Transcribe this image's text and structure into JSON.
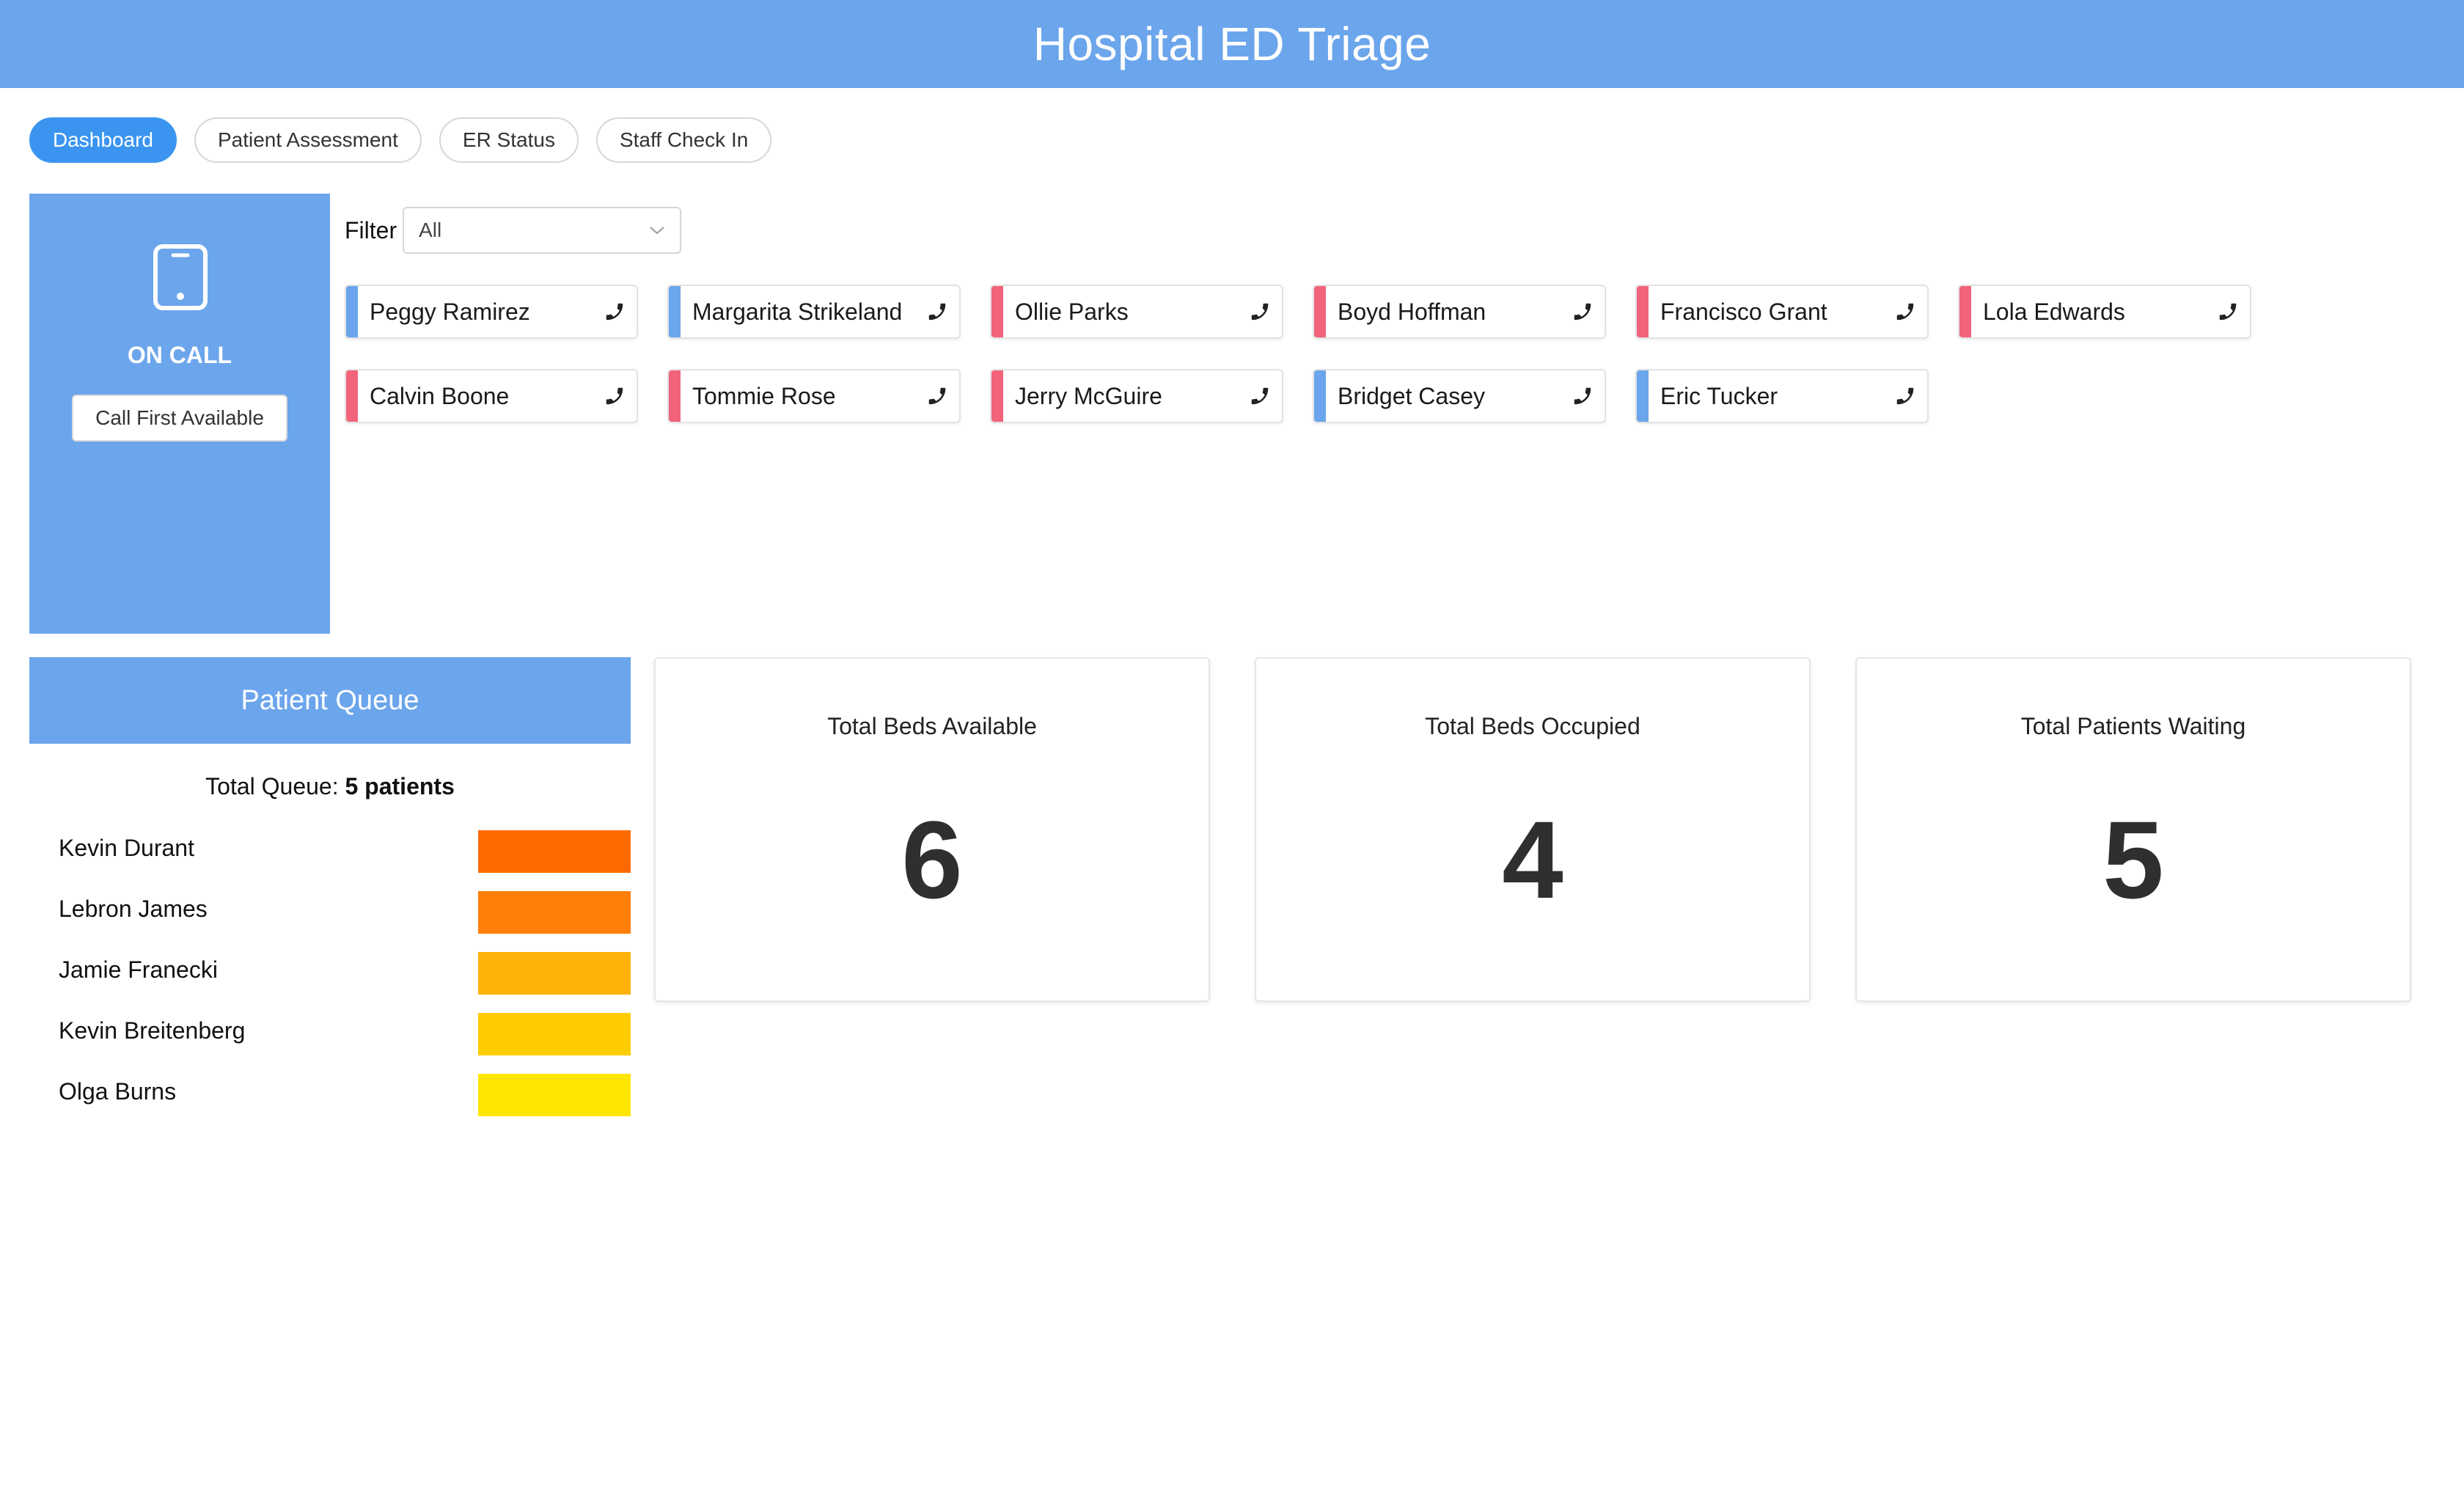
{
  "header": {
    "title": "Hospital ED Triage"
  },
  "tabs": [
    {
      "label": "Dashboard",
      "active": true
    },
    {
      "label": "Patient Assessment",
      "active": false
    },
    {
      "label": "ER Status",
      "active": false
    },
    {
      "label": "Staff Check In",
      "active": false
    }
  ],
  "oncall": {
    "icon": "tablet-phone-icon",
    "label": "ON CALL",
    "call_button": "Call First Available"
  },
  "filter": {
    "label": "Filter",
    "value": "All"
  },
  "colors": {
    "blue": "#6ba5ec",
    "red": "#f3637b",
    "accent": "#3b95f0"
  },
  "staff": [
    {
      "name": "Peggy Ramirez",
      "status": "blue"
    },
    {
      "name": "Margarita Strikeland",
      "status": "blue"
    },
    {
      "name": "Ollie Parks",
      "status": "red"
    },
    {
      "name": "Boyd Hoffman",
      "status": "red"
    },
    {
      "name": "Francisco Grant",
      "status": "red"
    },
    {
      "name": "Lola Edwards",
      "status": "red"
    },
    {
      "name": "Calvin Boone",
      "status": "red"
    },
    {
      "name": "Tommie Rose",
      "status": "red"
    },
    {
      "name": "Jerry McGuire",
      "status": "red"
    },
    {
      "name": "Bridget Casey",
      "status": "blue"
    },
    {
      "name": "Eric Tucker",
      "status": "blue"
    }
  ],
  "queue": {
    "title": "Patient Queue",
    "total_prefix": "Total Queue: ",
    "total_value": "5 patients",
    "patients": [
      {
        "name": "Kevin Durant",
        "color": "#ff6a00"
      },
      {
        "name": "Lebron James",
        "color": "#ff7f0a"
      },
      {
        "name": "Jamie Franecki",
        "color": "#ffb30a"
      },
      {
        "name": "Kevin Breitenberg",
        "color": "#ffcc00"
      },
      {
        "name": "Olga Burns",
        "color": "#ffe600"
      }
    ]
  },
  "stats": [
    {
      "title": "Total Beds Available",
      "value": "6"
    },
    {
      "title": "Total Beds Occupied",
      "value": "4"
    },
    {
      "title": "Total Patients Waiting",
      "value": "5"
    }
  ]
}
